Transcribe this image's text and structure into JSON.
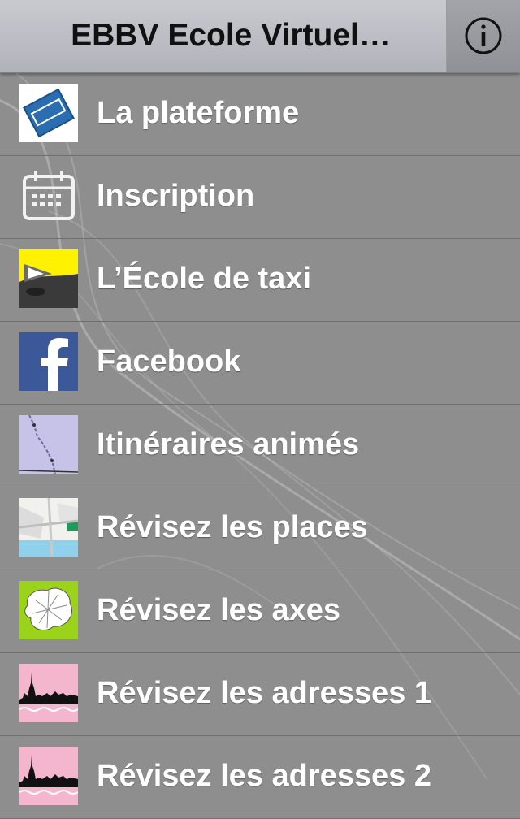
{
  "header": {
    "title": "EBBV Ecole Virtuel…",
    "info_icon": "info-icon"
  },
  "menu": {
    "items": [
      {
        "label": "La plateforme",
        "icon": "taxis-sign-icon"
      },
      {
        "label": "Inscription",
        "icon": "calendar-icon"
      },
      {
        "label": "L’École de taxi",
        "icon": "taxi-school-icon"
      },
      {
        "label": "Facebook",
        "icon": "facebook-icon"
      },
      {
        "label": "Itinéraires animés",
        "icon": "route-map-icon"
      },
      {
        "label": "Révisez les places",
        "icon": "places-map-icon"
      },
      {
        "label": "Révisez les axes",
        "icon": "axes-map-icon"
      },
      {
        "label": "Révisez les adresses 1",
        "icon": "paris-skyline-icon"
      },
      {
        "label": "Révisez les adresses 2",
        "icon": "paris-skyline-icon"
      }
    ]
  },
  "colors": {
    "background": "#8e8e8e",
    "header": "#bdbec4",
    "text": "#ffffff",
    "taxis_blue": "#2a6db0",
    "taxi_yellow": "#fff200",
    "facebook_blue": "#3b5998",
    "map_lavender": "#c7c3e8",
    "lime": "#9bd21a",
    "pink": "#f3b6cc"
  }
}
